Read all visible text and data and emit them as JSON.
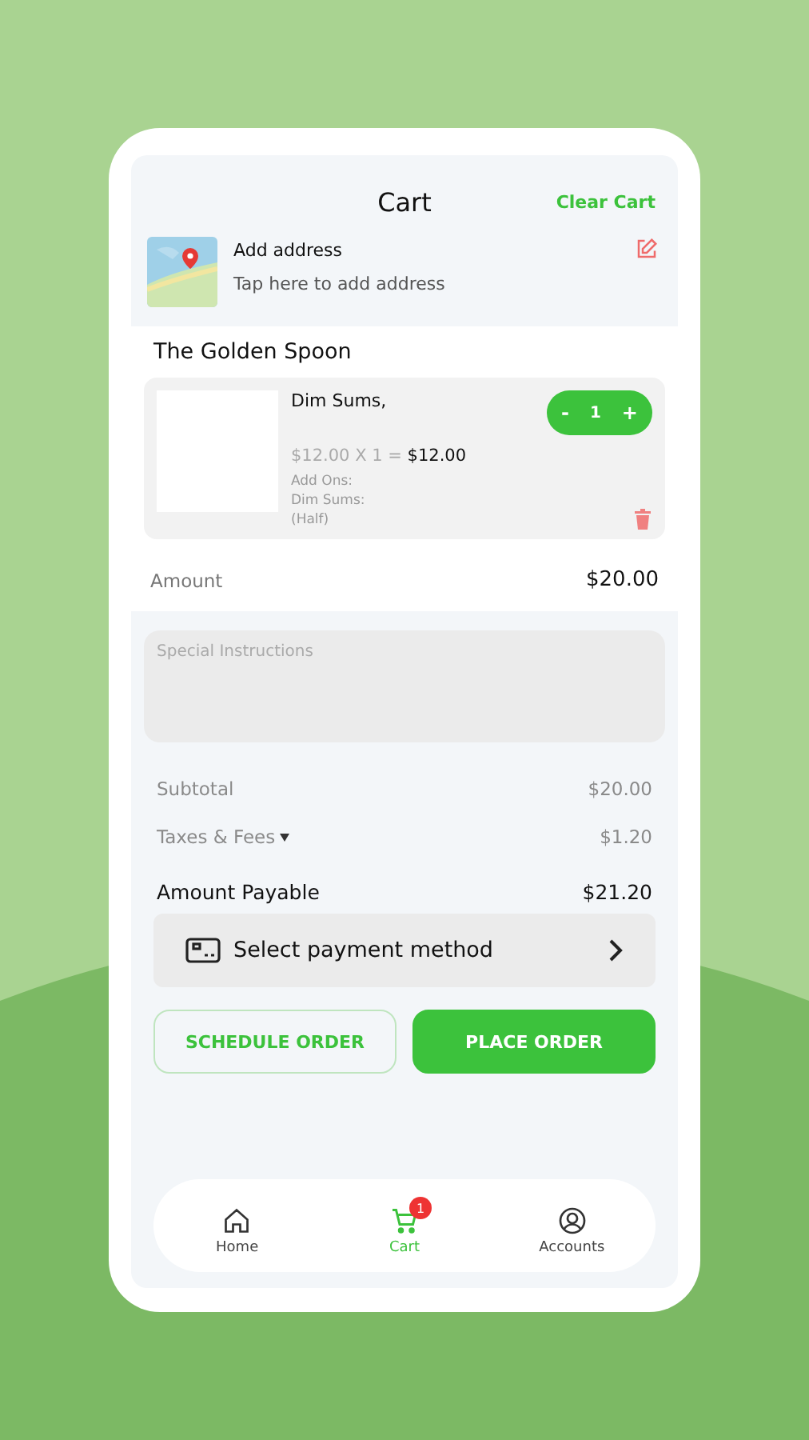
{
  "header": {
    "title": "Cart",
    "clear_action": "Clear Cart"
  },
  "address": {
    "title": "Add address",
    "subtitle": "Tap here to add address"
  },
  "restaurant": "The Golden Spoon",
  "items": [
    {
      "name": "Dim Sums,",
      "unit_price": "$12.00 X 1 =",
      "line_total": "$12.00",
      "addons_label": "Add Ons:",
      "addons": [
        "Dim Sums:",
        "(Half)"
      ],
      "stepper": {
        "minus": "-",
        "quantity": "1",
        "plus": "+"
      }
    }
  ],
  "amount": {
    "label": "Amount",
    "value": "$20.00"
  },
  "special_instructions": {
    "placeholder": "Special Instructions"
  },
  "summary": [
    {
      "kind": "minor",
      "label": "Subtotal",
      "value": "$20.00"
    },
    {
      "kind": "expandable",
      "label": "Taxes & Fees",
      "value": "$1.20"
    },
    {
      "kind": "total",
      "label": "Amount Payable",
      "value": "$21.20"
    }
  ],
  "payment": {
    "label": "Select payment method"
  },
  "actions": [
    {
      "kind": "outline",
      "label": "SCHEDULE ORDER"
    },
    {
      "kind": "filled",
      "label": "PLACE ORDER"
    }
  ],
  "nav": [
    {
      "kind": "home",
      "label": "Home",
      "selected": false
    },
    {
      "kind": "cart",
      "label": "Cart",
      "selected": true,
      "badge": "1"
    },
    {
      "kind": "account",
      "label": "Accounts",
      "selected": false
    }
  ]
}
